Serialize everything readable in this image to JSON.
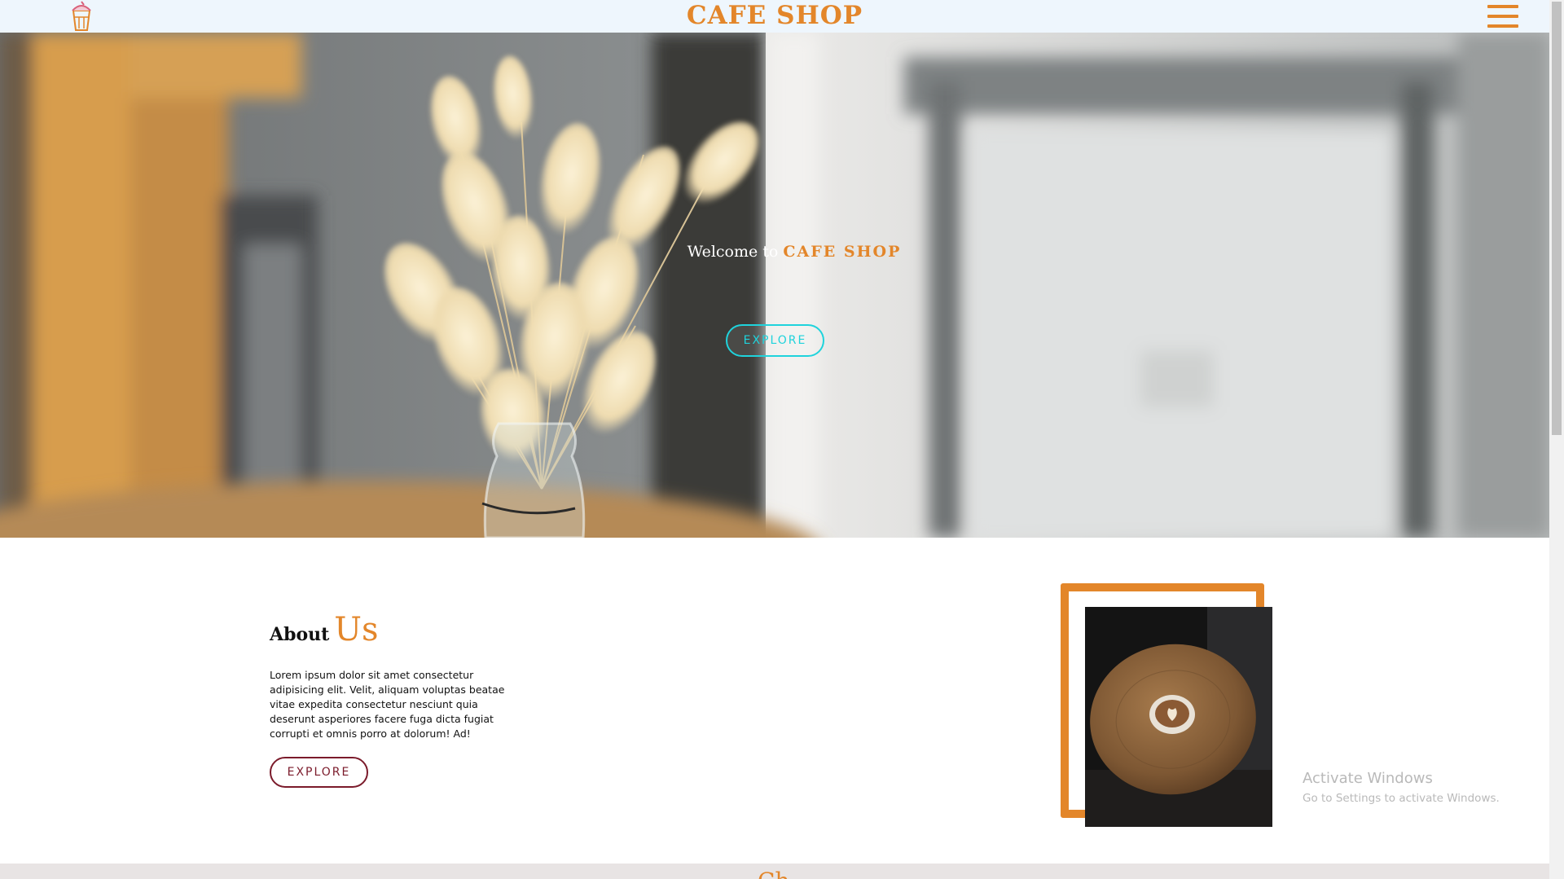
{
  "header": {
    "brand": "CAFE SHOP",
    "logo_icon": "cafe-cup-icon",
    "menu_icon": "hamburger-menu-icon"
  },
  "hero": {
    "welcome_prefix": "Welcome to",
    "welcome_brand": "CAFE SHOP",
    "button_label": "EXPLORE"
  },
  "about": {
    "title_part1": "About",
    "title_part2": "Us",
    "paragraph": "Lorem ipsum dolor sit amet consectetur adipisicing elit. Velit, aliquam voluptas beatae vitae expedita consectetur nesciunt quia deserunt asperiores facere fuga dicta fugiat corrupti et omnis porro at dolorum! Ad!",
    "button_label": "EXPLORE"
  },
  "watermark": {
    "title": "Activate Windows",
    "subtitle": "Go to Settings to activate Windows."
  },
  "next_section": {
    "heading": "Ch"
  },
  "colors": {
    "accent": "#e3862a",
    "nav_bg": "#eef6fd",
    "hero_button": "#1fd3dc",
    "about_button": "#7b1b2b"
  }
}
